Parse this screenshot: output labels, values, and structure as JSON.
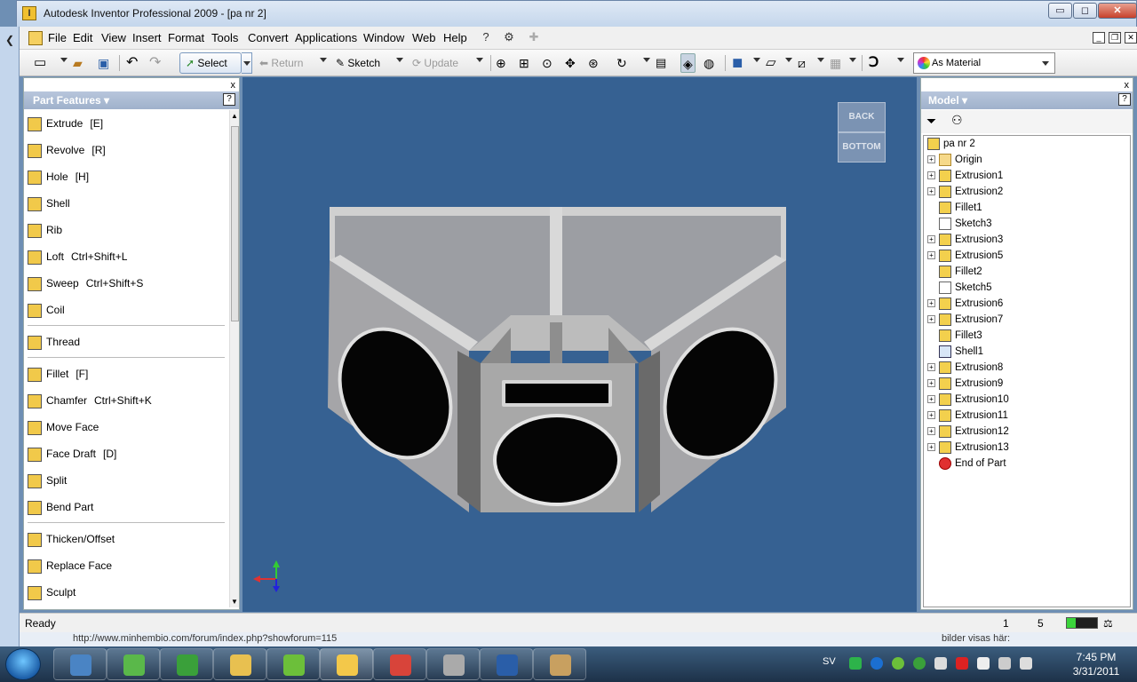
{
  "window": {
    "title": "Autodesk Inventor Professional 2009 - [pa nr 2]",
    "min_glyph": "▭",
    "max_glyph": "◻",
    "close_glyph": "✕"
  },
  "menubar": {
    "items": [
      "File",
      "Edit",
      "View",
      "Insert",
      "Format",
      "Tools",
      "Convert",
      "Applications",
      "Window",
      "Web",
      "Help"
    ]
  },
  "toolbar": {
    "select": "Select",
    "return": "Return",
    "sketch": "Sketch",
    "update": "Update",
    "material": "As Material"
  },
  "left_panel": {
    "title": "Part Features",
    "help": "?",
    "close": "x",
    "items": [
      {
        "label": "Extrude",
        "shortcut": "[E]",
        "icon": "extrude-icon"
      },
      {
        "label": "Revolve",
        "shortcut": "[R]",
        "icon": "revolve-icon"
      },
      {
        "label": "Hole",
        "shortcut": "[H]",
        "icon": "hole-icon"
      },
      {
        "label": "Shell",
        "shortcut": "",
        "icon": "shell-icon"
      },
      {
        "label": "Rib",
        "shortcut": "",
        "icon": "rib-icon"
      },
      {
        "label": "Loft",
        "shortcut": "Ctrl+Shift+L",
        "icon": "loft-icon"
      },
      {
        "label": "Sweep",
        "shortcut": "Ctrl+Shift+S",
        "icon": "sweep-icon"
      },
      {
        "label": "Coil",
        "shortcut": "",
        "icon": "coil-icon"
      },
      {
        "label": "Thread",
        "shortcut": "",
        "icon": "thread-icon"
      },
      {
        "label": "Fillet",
        "shortcut": "[F]",
        "icon": "fillet-icon"
      },
      {
        "label": "Chamfer",
        "shortcut": "Ctrl+Shift+K",
        "icon": "chamfer-icon"
      },
      {
        "label": "Move Face",
        "shortcut": "",
        "icon": "move-face-icon"
      },
      {
        "label": "Face Draft",
        "shortcut": "[D]",
        "icon": "face-draft-icon"
      },
      {
        "label": "Split",
        "shortcut": "",
        "icon": "split-icon"
      },
      {
        "label": "Bend Part",
        "shortcut": "",
        "icon": "bend-part-icon"
      },
      {
        "label": "Thicken/Offset",
        "shortcut": "",
        "icon": "thicken-icon"
      },
      {
        "label": "Replace Face",
        "shortcut": "",
        "icon": "replace-face-icon"
      },
      {
        "label": "Sculpt",
        "shortcut": "",
        "icon": "sculpt-icon"
      }
    ]
  },
  "viewcube": {
    "back": "BACK",
    "bottom": "BOTTOM"
  },
  "right_panel": {
    "title": "Model",
    "help": "?",
    "close": "x",
    "tree": [
      {
        "label": "pa nr 2",
        "type": "part",
        "expandable": false,
        "indent": 0
      },
      {
        "label": "Origin",
        "type": "folder",
        "expandable": true,
        "indent": 1
      },
      {
        "label": "Extrusion1",
        "type": "feature",
        "expandable": true,
        "indent": 1
      },
      {
        "label": "Extrusion2",
        "type": "feature",
        "expandable": true,
        "indent": 1
      },
      {
        "label": "Fillet1",
        "type": "fillet",
        "expandable": false,
        "indent": 1
      },
      {
        "label": "Sketch3",
        "type": "sketch",
        "expandable": false,
        "indent": 1
      },
      {
        "label": "Extrusion3",
        "type": "feature",
        "expandable": true,
        "indent": 1
      },
      {
        "label": "Extrusion5",
        "type": "feature",
        "expandable": true,
        "indent": 1
      },
      {
        "label": "Fillet2",
        "type": "fillet",
        "expandable": false,
        "indent": 1
      },
      {
        "label": "Sketch5",
        "type": "sketch",
        "expandable": false,
        "indent": 1
      },
      {
        "label": "Extrusion6",
        "type": "feature",
        "expandable": true,
        "indent": 1
      },
      {
        "label": "Extrusion7",
        "type": "feature",
        "expandable": true,
        "indent": 1
      },
      {
        "label": "Fillet3",
        "type": "fillet",
        "expandable": false,
        "indent": 1
      },
      {
        "label": "Shell1",
        "type": "shell",
        "expandable": false,
        "indent": 1
      },
      {
        "label": "Extrusion8",
        "type": "feature",
        "expandable": true,
        "indent": 1
      },
      {
        "label": "Extrusion9",
        "type": "feature",
        "expandable": true,
        "indent": 1
      },
      {
        "label": "Extrusion10",
        "type": "feature",
        "expandable": true,
        "indent": 1
      },
      {
        "label": "Extrusion11",
        "type": "feature",
        "expandable": true,
        "indent": 1
      },
      {
        "label": "Extrusion12",
        "type": "feature",
        "expandable": true,
        "indent": 1
      },
      {
        "label": "Extrusion13",
        "type": "feature",
        "expandable": true,
        "indent": 1
      },
      {
        "label": "End of Part",
        "type": "end",
        "expandable": false,
        "indent": 1
      }
    ]
  },
  "statusbar": {
    "text": "Ready",
    "count1": "1",
    "count2": "5",
    "meter_fraction": 0.3
  },
  "background_window": {
    "url_hint": "http://www.minhembio.com/forum/index.php?showforum=115",
    "right_hint": "bilder visas här:"
  },
  "taskbar": {
    "lang": "SV",
    "time": "7:45 PM",
    "date": "3/31/2011",
    "apps": [
      {
        "name": "desktop-app",
        "color": "#4a84c4"
      },
      {
        "name": "messenger-app",
        "color": "#5ab84a"
      },
      {
        "name": "utorrent-app",
        "color": "#3aa03a"
      },
      {
        "name": "explorer-app",
        "color": "#e8c050"
      },
      {
        "name": "spotify-app",
        "color": "#6cbf3a"
      },
      {
        "name": "inventor-app",
        "color": "#f3c84a"
      },
      {
        "name": "chrome-app",
        "color": "#d8443a"
      },
      {
        "name": "media-app",
        "color": "#aaaaaa"
      },
      {
        "name": "word-app",
        "color": "#2a5ea8"
      },
      {
        "name": "paint-app",
        "color": "#c8a060"
      }
    ]
  },
  "colors": {
    "viewport_bg": "#366192",
    "panel_header": "#a9b9d0",
    "model_face": "#a8a8a8",
    "model_light": "#d6d6d6",
    "speaker": "#050505"
  }
}
